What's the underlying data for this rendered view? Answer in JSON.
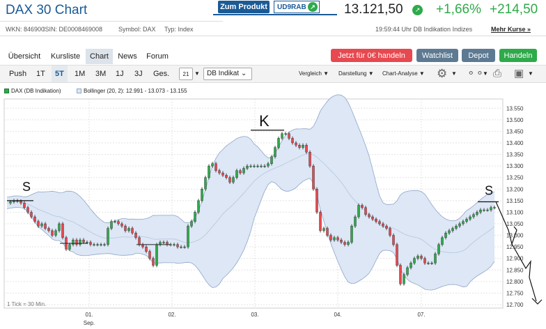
{
  "header": {
    "title": "DAX 30 Chart",
    "product_button": "Zum Produkt",
    "product_code": "UD9RAB",
    "price": "13.121,50",
    "change_pct": "+1,66%",
    "change_abs": "+214,50"
  },
  "info": {
    "wkn": "WKN: 846900",
    "isin": "ISIN: DE0008469008",
    "symbol": "Symbol: DAX",
    "typ": "Typ: Index",
    "time": "19:59:44 Uhr DB Indikation Indizes",
    "more_link": "Mehr Kurse »"
  },
  "tabs": [
    "Übersicht",
    "Kursliste",
    "Chart",
    "News",
    "Forum"
  ],
  "actions": {
    "trade_free": "Jetzt für 0€ handeln",
    "watchlist": "Watchlist",
    "depot": "Depot",
    "handeln": "Handeln"
  },
  "toolbar": {
    "periods": [
      "Push",
      "1T",
      "5T",
      "1M",
      "3M",
      "1J",
      "3J",
      "Ges."
    ],
    "active_period": "5T",
    "calendar_day": "21",
    "source_select": "DB Indikat",
    "compare": "Vergleich",
    "display": "Darstellung",
    "analysis": "Chart-Analyse"
  },
  "legend": {
    "series1": "DAX (DB Indikation)",
    "series2": "Bollinger (20, 2): 12.991 - 13.073 - 13.155"
  },
  "footnote": "1 Tick = 30 Min.",
  "annotations": {
    "support1": "S",
    "resist": "K",
    "support2": "S"
  },
  "colors": {
    "accent": "#1a5a96",
    "up": "#2eaa4a",
    "red": "#e8484f",
    "band": "#dde7f5"
  },
  "chart_data": {
    "type": "candlestick",
    "y_ticks": [
      "13.550",
      "13.500",
      "13.450",
      "13.400",
      "13.350",
      "13.300",
      "13.250",
      "13.200",
      "13.150",
      "13.100",
      "13.050",
      "13.000",
      "12.950",
      "12.900",
      "12.850",
      "12.800",
      "12.750",
      "12.700"
    ],
    "ylim": [
      12685,
      13590
    ],
    "x_labels": [
      "01.",
      "02.",
      "03.",
      "04.",
      "07."
    ],
    "x_sublabel": "Sep.",
    "close": [
      13140,
      13145,
      13150,
      13148,
      13140,
      13120,
      13100,
      13080,
      13060,
      13040,
      13050,
      13030,
      13020,
      13000,
      13020,
      13050,
      12990,
      12940,
      12960,
      12980,
      12960,
      12980,
      12970,
      12970,
      12960,
      12960,
      12960,
      12960,
      12960,
      13030,
      13060,
      13060,
      13050,
      13040,
      13020,
      13030,
      13010,
      12990,
      12960,
      12950,
      12930,
      12900,
      12870,
      12960,
      12970,
      12970,
      12960,
      12960,
      12960,
      12950,
      12950,
      12950,
      13040,
      13060,
      13100,
      13150,
      13200,
      13250,
      13300,
      13310,
      13280,
      13270,
      13260,
      13250,
      13230,
      13250,
      13280,
      13270,
      13290,
      13300,
      13300,
      13300,
      13300,
      13300,
      13300,
      13310,
      13340,
      13380,
      13420,
      13440,
      13440,
      13420,
      13400,
      13390,
      13380,
      13390,
      13360,
      13300,
      13200,
      13100,
      13020,
      13030,
      13000,
      12980,
      12990,
      12980,
      12970,
      12960,
      12970,
      13040,
      13080,
      13130,
      13120,
      13090,
      13080,
      13070,
      13060,
      13050,
      13040,
      13030,
      13000,
      12960,
      12870,
      12790,
      12830,
      12860,
      12880,
      12900,
      12910,
      12900,
      12880,
      12880,
      12880,
      12920,
      12960,
      12990,
      13010,
      13020,
      13030,
      13040,
      13050,
      13060,
      13070,
      13080,
      13090,
      13100,
      13110,
      13110,
      13110,
      13120,
      13121
    ]
  }
}
